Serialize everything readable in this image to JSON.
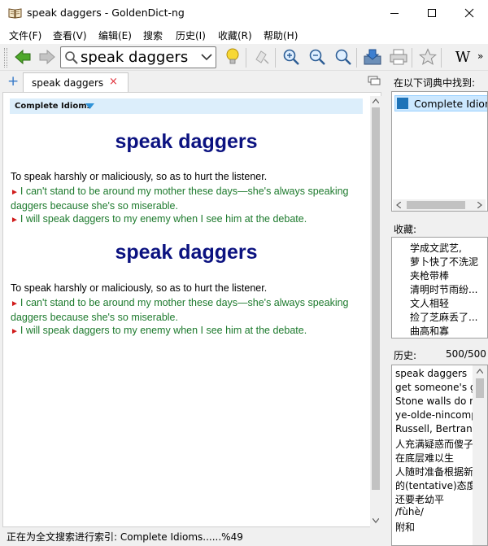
{
  "window": {
    "title": "speak daggers - GoldenDict-ng"
  },
  "menu": [
    "文件(F)",
    "查看(V)",
    "编辑(E)",
    "搜索",
    "历史(I)",
    "收藏(R)",
    "帮助(H)"
  ],
  "toolbar": {
    "search_value": "speak daggers",
    "more": "»"
  },
  "tab": {
    "label": "speak daggers",
    "close": "×",
    "add": "+"
  },
  "article": {
    "dictionary_name": "Complete Idioms",
    "entries": [
      {
        "headword": "speak daggers",
        "definition": "To speak harshly or maliciously, so as to hurt the listener.",
        "examples": [
          "I can't stand to be around my mother these days—she's always speaking daggers because she's so miserable.",
          "I will speak daggers to my enemy when I see him at the debate."
        ]
      },
      {
        "headword": "speak daggers",
        "definition": "To speak harshly or maliciously, so as to hurt the listener.",
        "examples": [
          "I can't stand to be around my mother these days—she's always speaking daggers because she's so miserable.",
          "I will speak daggers to my enemy when I see him at the debate."
        ]
      }
    ]
  },
  "status": {
    "text": "正在为全文搜索进行索引: Complete Idioms......%49"
  },
  "found_in": {
    "label": "在以下词典中找到:",
    "items": [
      "Complete Idioms"
    ]
  },
  "favorites": {
    "label": "收藏:",
    "items": [
      "学成文武艺,",
      "萝卜快了不洗泥",
      "夹枪带棒",
      "清明时节雨纷...",
      "文人相轻",
      "捡了芝麻丢了...",
      "曲高和寡"
    ]
  },
  "history": {
    "label": "历史:",
    "count": "500/500",
    "items": [
      "speak daggers",
      "get someone's g",
      "Stone walls do n",
      "ye-olde-nincomp",
      "Russell, Bertranc",
      "人充满疑惑而傻子",
      "在底层难以生",
      "人随时准备根据新",
      "的(tentative)态度",
      "还要老幼平",
      "/fùhè/",
      "附和"
    ]
  }
}
